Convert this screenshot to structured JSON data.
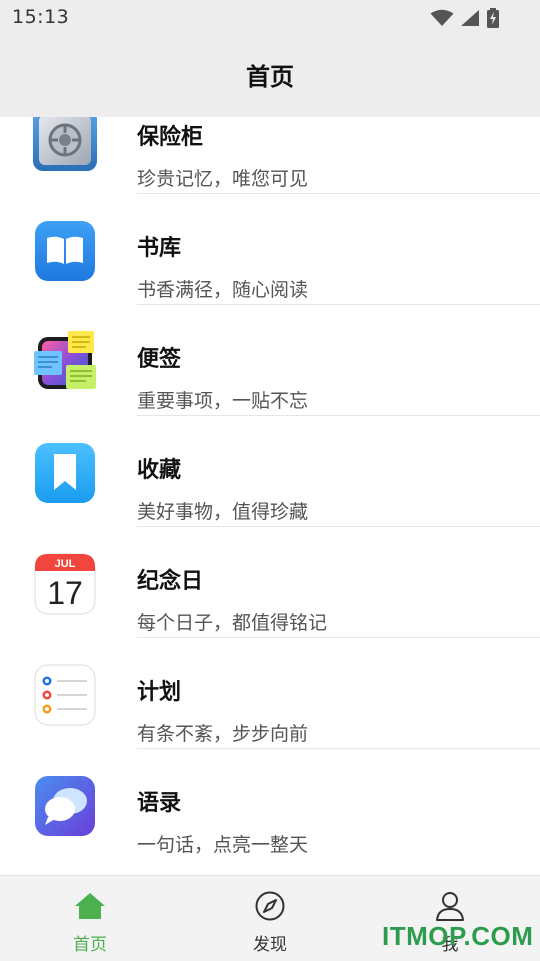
{
  "status_bar": {
    "time": "15:13",
    "icons": [
      "wifi-icon",
      "signal-icon",
      "battery-icon"
    ]
  },
  "header": {
    "title": "首页"
  },
  "items": [
    {
      "title": "保险柜",
      "subtitle": "珍贵记忆，唯您可见",
      "icon": "safe-icon"
    },
    {
      "title": "书库",
      "subtitle": "书香满径，随心阅读",
      "icon": "books-icon"
    },
    {
      "title": "便签",
      "subtitle": "重要事项，一贴不忘",
      "icon": "stickies-icon"
    },
    {
      "title": "收藏",
      "subtitle": "美好事物，值得珍藏",
      "icon": "bookmark-icon"
    },
    {
      "title": "纪念日",
      "subtitle": "每个日子，都值得铭记",
      "icon": "calendar-icon",
      "calendar_month": "JUL",
      "calendar_day": "17"
    },
    {
      "title": "计划",
      "subtitle": "有条不紊，步步向前",
      "icon": "reminders-icon"
    },
    {
      "title": "语录",
      "subtitle": "一句话，点亮一整天",
      "icon": "messages-icon"
    }
  ],
  "tab_bar": {
    "tabs": [
      {
        "label": "首页",
        "icon": "home-icon",
        "active": true
      },
      {
        "label": "发现",
        "icon": "compass-icon",
        "active": false
      },
      {
        "label": "我",
        "icon": "user-icon",
        "active": false
      }
    ]
  },
  "watermark": "ITMOP.COM",
  "colors": {
    "accent": "#4caf50",
    "header_bg": "#ededed",
    "watermark": "#2e9c4f"
  }
}
